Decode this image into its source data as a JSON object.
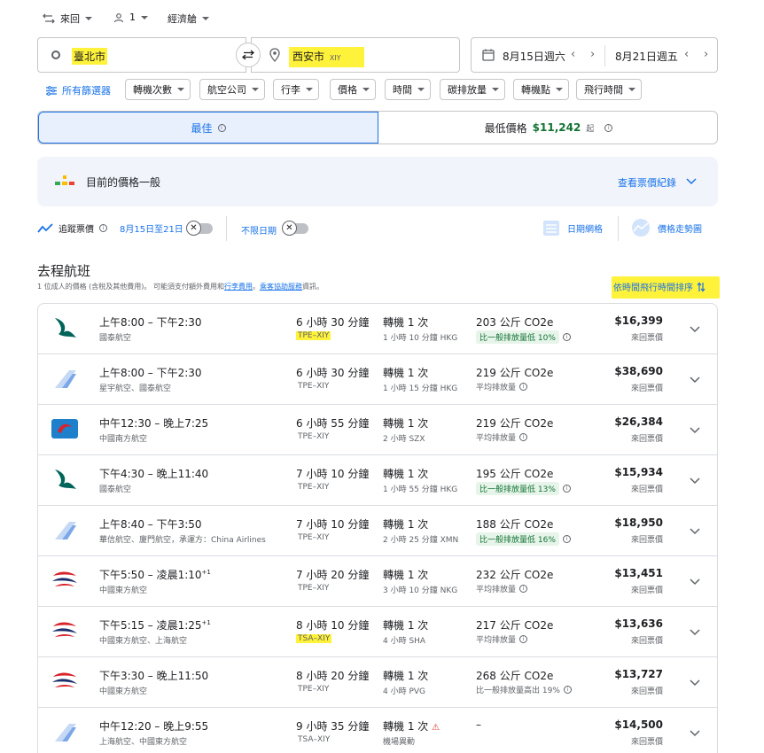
{
  "topbar": {
    "trip_type": "來回",
    "passengers": "1",
    "cabin": "經濟艙"
  },
  "search": {
    "origin": "臺北市",
    "destination": "西安市",
    "destination_code": "XIY",
    "depart_date": "8月15日週六",
    "return_date": "8月21日週五"
  },
  "filters": {
    "all_filters": "所有篩選器",
    "chips": [
      "轉機次數",
      "航空公司",
      "行李",
      "價格",
      "時間",
      "碳排放量",
      "轉機點",
      "飛行時間"
    ]
  },
  "sort_tabs": {
    "best": "最佳",
    "cheapest_label": "最低價格",
    "cheapest_price": "$11,242",
    "cheapest_suffix": "起"
  },
  "price_insight": {
    "text": "目前的價格一般",
    "history_link": "查看票價紀錄"
  },
  "tracking": {
    "track_label": "追蹤票價",
    "track_dates": "8月15日至21日",
    "any_dates": "不限日期",
    "date_grid": "日期網格",
    "price_graph": "價格走勢圖"
  },
  "section": {
    "title": "去程航班",
    "subtitle_prefix": "1 位成人的價格 (含稅及其他費用)。 可能須支付額外費用和",
    "subtitle_link1": "行李費用",
    "subtitle_sep": "。",
    "subtitle_link2": "乘客協助服務",
    "subtitle_suffix": "資訊。",
    "sort_label": "依時間飛行時間排序"
  },
  "price_type": "來回票價",
  "flights": [
    {
      "logo": "cathay-logo",
      "time": "上午8:00 – 下午2:30",
      "plus": "",
      "airline": "國泰航空",
      "duration": "6 小時 30 分鐘",
      "route": "TPE–XIY",
      "stops": "轉機 1 次",
      "layover": "1 小時 10 分鐘 HKG",
      "co2": "203 公斤 CO2e",
      "emissions": "比一般排放量低 10%",
      "emis_green": true,
      "price": "$16,399"
    },
    {
      "logo": "generic-logo",
      "time": "上午8:00 – 下午2:30",
      "plus": "",
      "airline": "星宇航空、國泰航空",
      "duration": "6 小時 30 分鐘",
      "route": "TPE–XIY",
      "stops": "轉機 1 次",
      "layover": "1 小時 15 分鐘 HKG",
      "co2": "219 公斤 CO2e",
      "emissions": "平均排放量",
      "emis_green": false,
      "price": "$38,690"
    },
    {
      "logo": "china-southern-logo",
      "time": "中午12:30 – 晚上7:25",
      "plus": "",
      "airline": "中國南方航空",
      "duration": "6 小時 55 分鐘",
      "route": "TPE–XIY",
      "stops": "轉機 1 次",
      "layover": "2 小時 SZX",
      "co2": "219 公斤 CO2e",
      "emissions": "平均排放量",
      "emis_green": false,
      "price": "$26,384"
    },
    {
      "logo": "cathay-logo",
      "time": "下午4:30 – 晚上11:40",
      "plus": "",
      "airline": "國泰航空",
      "duration": "7 小時 10 分鐘",
      "route": "TPE–XIY",
      "stops": "轉機 1 次",
      "layover": "1 小時 55 分鐘 HKG",
      "co2": "195 公斤 CO2e",
      "emissions": "比一般排放量低 13%",
      "emis_green": true,
      "price": "$15,934"
    },
    {
      "logo": "generic-logo",
      "time": "上午8:40 – 下午3:50",
      "plus": "",
      "airline": "華信航空、廈門航空，承運方：China Airlines",
      "duration": "7 小時 10 分鐘",
      "route": "TPE–XIY",
      "stops": "轉機 1 次",
      "layover": "2 小時 25 分鐘 XMN",
      "co2": "188 公斤 CO2e",
      "emissions": "比一般排放量低 16%",
      "emis_green": true,
      "price": "$18,950"
    },
    {
      "logo": "china-eastern-logo",
      "time": "下午5:50 – 凌晨1:10",
      "plus": "+1",
      "airline": "中國東方航空",
      "duration": "7 小時 20 分鐘",
      "route": "TPE–XIY",
      "stops": "轉機 1 次",
      "layover": "3 小時 10 分鐘 NKG",
      "co2": "232 公斤 CO2e",
      "emissions": "平均排放量",
      "emis_green": false,
      "price": "$13,451"
    },
    {
      "logo": "china-eastern-logo",
      "time": "下午5:15 – 凌晨1:25",
      "plus": "+1",
      "airline": "中國東方航空、上海航空",
      "duration": "8 小時 10 分鐘",
      "route": "TSA–XIY",
      "stops": "轉機 1 次",
      "layover": "4 小時 SHA",
      "co2": "217 公斤 CO2e",
      "emissions": "平均排放量",
      "emis_green": false,
      "price": "$13,636"
    },
    {
      "logo": "china-eastern-logo",
      "time": "下午3:30 – 晚上11:50",
      "plus": "",
      "airline": "中國東方航空",
      "duration": "8 小時 20 分鐘",
      "route": "TPE–XIY",
      "stops": "轉機 1 次",
      "layover": "4 小時 PVG",
      "co2": "268 公斤 CO2e",
      "emissions": "比一般排放量高出 19%",
      "emis_green": false,
      "price": "$13,727"
    },
    {
      "logo": "generic-logo",
      "time": "中午12:20 – 晚上9:55",
      "plus": "",
      "airline": "上海航空、中國東方航空",
      "duration": "9 小時 35 分鐘",
      "route": "TSA–XIY",
      "stops": "轉機 1 次",
      "layover": "機場異動",
      "co2": "–",
      "emissions": "",
      "emis_green": false,
      "price": "$14,500",
      "warning": true
    }
  ],
  "colors": {
    "accent": "#1a73e8",
    "price_green": "#137333",
    "highlight": "#fff23a"
  }
}
